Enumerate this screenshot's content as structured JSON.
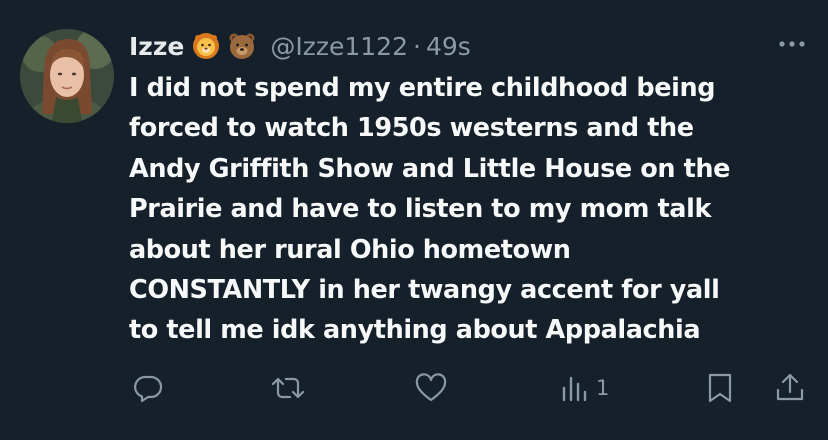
{
  "tweet": {
    "display_name": "Izze",
    "emojis": [
      "lion-face-emoji",
      "bear-face-emoji"
    ],
    "handle": "@Izze1122",
    "separator": "·",
    "time": "49s",
    "more_icon": "ellipsis-icon",
    "text_lines": [
      "I did not spend my entire childhood being",
      "forced to watch 1950s westerns and the",
      "Andy Griffith Show and Little House on the",
      "Prairie and have to listen to my mom talk",
      "about her rural Ohio hometown",
      "CONSTANTLY in her twangy accent for yall",
      "to tell me idk anything about Appalachia"
    ]
  },
  "actions": {
    "reply_icon": "reply-icon",
    "retweet_icon": "retweet-icon",
    "like_icon": "heart-icon",
    "views_icon": "views-chart-icon",
    "views_count": "1",
    "bookmark_icon": "bookmark-icon",
    "share_icon": "share-icon"
  },
  "colors": {
    "background": "#15202b",
    "text": "#f7f9f9",
    "secondary": "#8b98a5"
  }
}
